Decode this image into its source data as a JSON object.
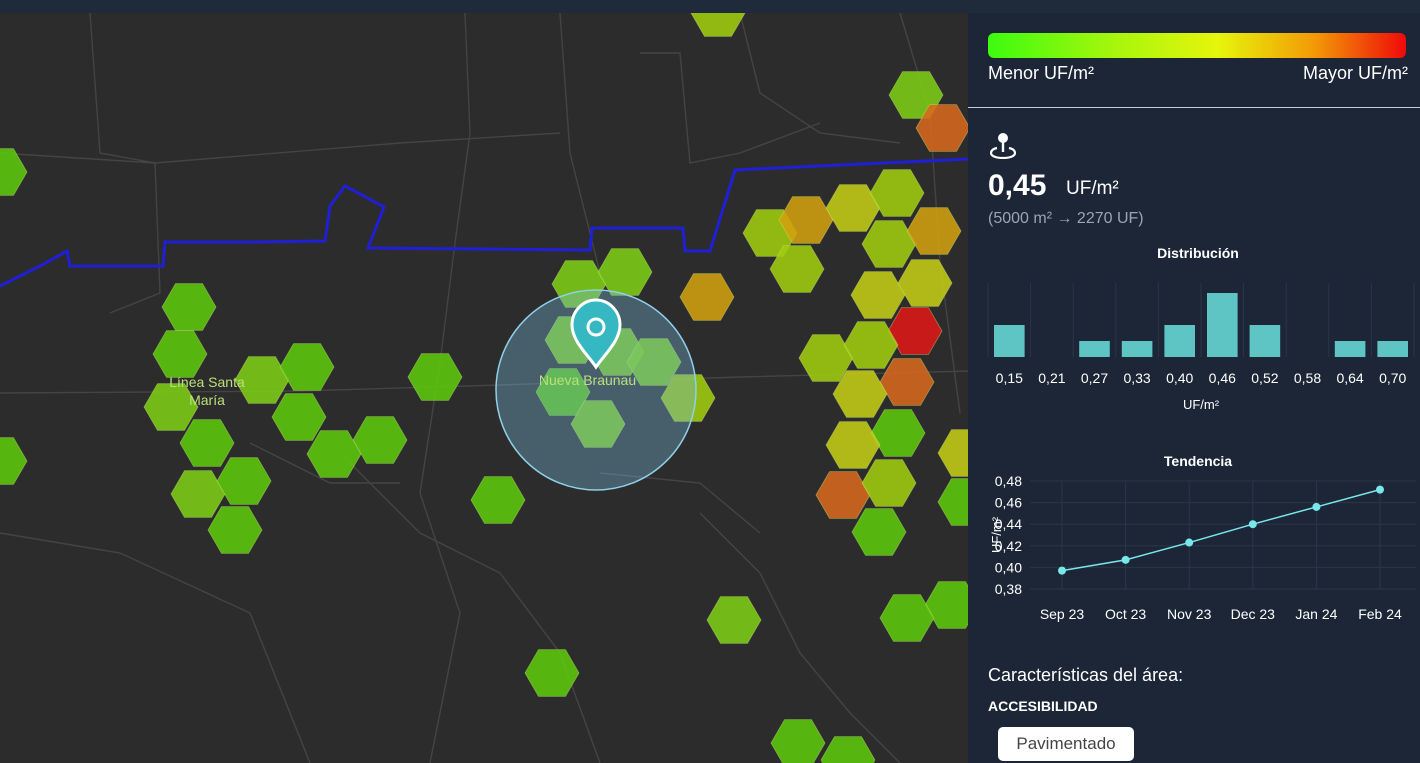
{
  "legend": {
    "min_label": "Menor UF/m²",
    "max_label": "Mayor UF/m²"
  },
  "price": {
    "value": "0,45",
    "unit": "UF/m²",
    "detail": "(5000 m² → 2270 UF)"
  },
  "distribution_title": "Distribución",
  "trend_title": "Tendencia",
  "map": {
    "labels": [
      "Línea Santa María",
      "Nueva Braunau"
    ]
  },
  "features": {
    "title": "Características del área:",
    "subtitle": "ACCESIBILIDAD",
    "chip": "Pavimentado"
  },
  "colors": {
    "bars": "#5ec4c4",
    "line": "#79e8ec",
    "boundary": "#1f1fd6",
    "selection": "#6fb9d9"
  },
  "chart_data": [
    {
      "type": "bar",
      "title": "Distribución",
      "categories": [
        "0,15",
        "0,21",
        "0,27",
        "0,33",
        "0,40",
        "0,46",
        "0,52",
        "0,58",
        "0,64",
        "0,70"
      ],
      "values": [
        2,
        0,
        1,
        1,
        2,
        4,
        2,
        0,
        1,
        1
      ],
      "xlabel": "UF/m²",
      "ylabel": ""
    },
    {
      "type": "line",
      "title": "Tendencia",
      "categories": [
        "Sep 23",
        "Oct 23",
        "Nov 23",
        "Dec 23",
        "Jan 24",
        "Feb 24"
      ],
      "values": [
        0.397,
        0.407,
        0.423,
        0.44,
        0.456,
        0.472
      ],
      "yticks": [
        "0,38",
        "0,40",
        "0,42",
        "0,44",
        "0,46",
        "0,48"
      ],
      "ylim": [
        0.38,
        0.48
      ],
      "ylabel": "UF/m²",
      "xlabel": ""
    }
  ]
}
